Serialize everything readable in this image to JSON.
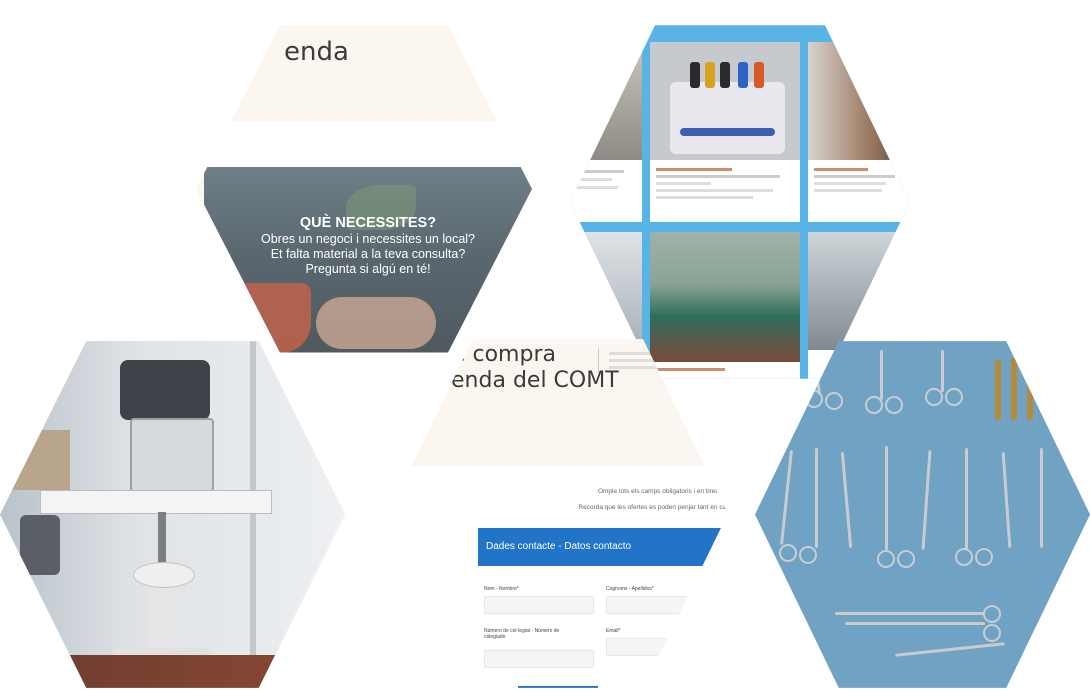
{
  "banner": {
    "title_fragment": "enda",
    "heading": "QUÈ NECESSITES?",
    "lines": [
      "Obres un negoci i necessites un local?",
      "Et falta material a la teva consulta?",
      "Pregunta si algú en té!"
    ]
  },
  "form_page": {
    "title_line1": "de compra",
    "title_line2": "venda del COMT",
    "instructions": [
      "Omple tots els camps obligatoris i en breu, fo",
      "Recorda que les ofertes es poden penjar tant en cat"
    ],
    "form_header": "Dades contacte - Datos contacto",
    "fields": [
      {
        "label": "Nom - Nombre*"
      },
      {
        "label": "Cognoms - Apellidos*"
      },
      {
        "label": "Número de col·legiat - Número de colegiado"
      },
      {
        "label": "Email*"
      }
    ]
  },
  "colors": {
    "form_blue": "#2274c9",
    "listing_blue": "#58b4e6",
    "cream": "#fbf7f0",
    "instrument_bg": "#6fa2c3"
  }
}
